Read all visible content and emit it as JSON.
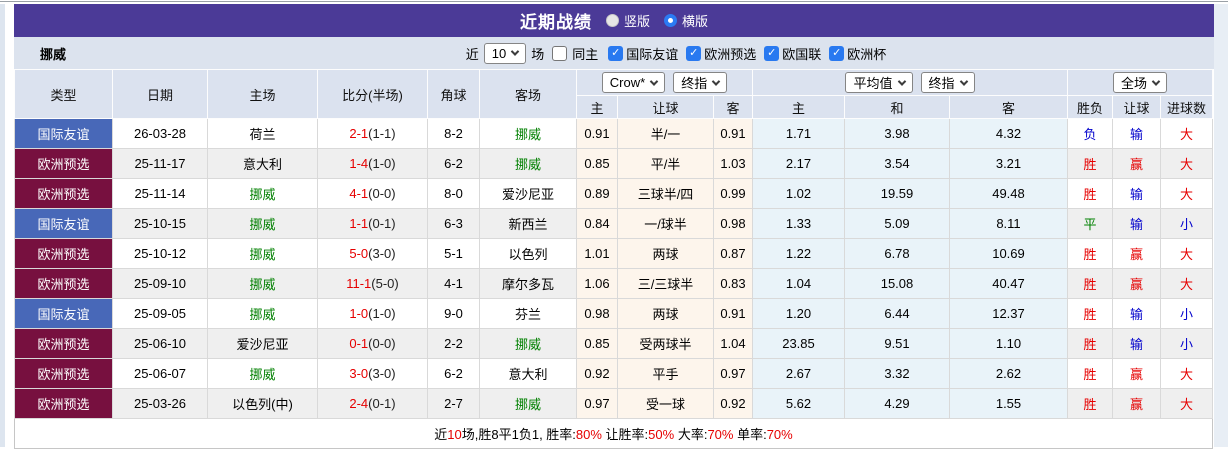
{
  "colors": {
    "header_purple": "#4b3a97",
    "type_friendly_blue": "#4868b8",
    "type_qualifier_maroon": "#77103f",
    "win_red": "#e60000",
    "loss_blue": "#0000cc",
    "draw_green": "#008000",
    "norway_green": "#008000",
    "odds_cream_bg": "#fdf5ec",
    "avg_blue_bg": "#e9f3f9"
  },
  "titlebar": {
    "title": "近期战绩",
    "radio_vertical": "竖版",
    "radio_horizontal": "横版"
  },
  "filterbar": {
    "team": "挪威",
    "near_label": "近",
    "count_value": "10",
    "games_label": "场",
    "same_home_label": "同主",
    "leagues": [
      "国际友谊",
      "欧洲预选",
      "欧国联",
      "欧洲杯"
    ]
  },
  "table": {
    "selects": {
      "bookmaker": "Crow*",
      "bookmaker_final": "终指",
      "average": "平均值",
      "average_final": "终指",
      "scope": "全场"
    },
    "columns": [
      "类型",
      "日期",
      "主场",
      "比分(半场)",
      "角球",
      "客场",
      "主",
      "让球",
      "客",
      "主",
      "和",
      "客",
      "胜负",
      "让球",
      "进球数"
    ],
    "rows": [
      {
        "type": "国际友谊",
        "type_style": "blue",
        "date": "26-03-28",
        "home": "荷兰",
        "home_norway": false,
        "score": "2-1",
        "half": "(1-1)",
        "corners": "8-2",
        "away": "挪威",
        "away_norway": true,
        "o_home": "0.91",
        "handicap": "半/一",
        "o_away": "0.91",
        "a_home": "1.71",
        "a_draw": "3.98",
        "a_away": "4.32",
        "wl": "负",
        "wl_color": "blue",
        "hc": "输",
        "hc_color": "blue",
        "goal": "大",
        "goal_color": "red"
      },
      {
        "type": "欧洲预选",
        "type_style": "maroon",
        "date": "25-11-17",
        "home": "意大利",
        "home_norway": false,
        "score": "1-4",
        "half": "(1-0)",
        "corners": "6-2",
        "away": "挪威",
        "away_norway": true,
        "o_home": "0.85",
        "handicap": "平/半",
        "o_away": "1.03",
        "a_home": "2.17",
        "a_draw": "3.54",
        "a_away": "3.21",
        "wl": "胜",
        "wl_color": "red",
        "hc": "赢",
        "hc_color": "red",
        "goal": "大",
        "goal_color": "red"
      },
      {
        "type": "欧洲预选",
        "type_style": "maroon",
        "date": "25-11-14",
        "home": "挪威",
        "home_norway": true,
        "score": "4-1",
        "half": "(0-0)",
        "corners": "8-0",
        "away": "爱沙尼亚",
        "away_norway": false,
        "o_home": "0.89",
        "handicap": "三球半/四",
        "o_away": "0.99",
        "a_home": "1.02",
        "a_draw": "19.59",
        "a_away": "49.48",
        "wl": "胜",
        "wl_color": "red",
        "hc": "输",
        "hc_color": "blue",
        "goal": "大",
        "goal_color": "red"
      },
      {
        "type": "国际友谊",
        "type_style": "blue",
        "date": "25-10-15",
        "home": "挪威",
        "home_norway": true,
        "score": "1-1",
        "half": "(0-1)",
        "corners": "6-3",
        "away": "新西兰",
        "away_norway": false,
        "o_home": "0.84",
        "handicap": "一/球半",
        "o_away": "0.98",
        "a_home": "1.33",
        "a_draw": "5.09",
        "a_away": "8.11",
        "wl": "平",
        "wl_color": "green",
        "hc": "输",
        "hc_color": "blue",
        "goal": "小",
        "goal_color": "blue"
      },
      {
        "type": "欧洲预选",
        "type_style": "maroon",
        "date": "25-10-12",
        "home": "挪威",
        "home_norway": true,
        "score": "5-0",
        "half": "(3-0)",
        "corners": "5-1",
        "away": "以色列",
        "away_norway": false,
        "o_home": "1.01",
        "handicap": "两球",
        "o_away": "0.87",
        "a_home": "1.22",
        "a_draw": "6.78",
        "a_away": "10.69",
        "wl": "胜",
        "wl_color": "red",
        "hc": "赢",
        "hc_color": "red",
        "goal": "大",
        "goal_color": "red"
      },
      {
        "type": "欧洲预选",
        "type_style": "maroon",
        "date": "25-09-10",
        "home": "挪威",
        "home_norway": true,
        "score": "11-1",
        "half": "(5-0)",
        "corners": "4-1",
        "away": "摩尔多瓦",
        "away_norway": false,
        "o_home": "1.06",
        "handicap": "三/三球半",
        "o_away": "0.83",
        "a_home": "1.04",
        "a_draw": "15.08",
        "a_away": "40.47",
        "wl": "胜",
        "wl_color": "red",
        "hc": "赢",
        "hc_color": "red",
        "goal": "大",
        "goal_color": "red"
      },
      {
        "type": "国际友谊",
        "type_style": "blue",
        "date": "25-09-05",
        "home": "挪威",
        "home_norway": true,
        "score": "1-0",
        "half": "(1-0)",
        "corners": "9-0",
        "away": "芬兰",
        "away_norway": false,
        "o_home": "0.98",
        "handicap": "两球",
        "o_away": "0.91",
        "a_home": "1.20",
        "a_draw": "6.44",
        "a_away": "12.37",
        "wl": "胜",
        "wl_color": "red",
        "hc": "输",
        "hc_color": "blue",
        "goal": "小",
        "goal_color": "blue"
      },
      {
        "type": "欧洲预选",
        "type_style": "maroon",
        "date": "25-06-10",
        "home": "爱沙尼亚",
        "home_norway": false,
        "score": "0-1",
        "half": "(0-0)",
        "corners": "2-2",
        "away": "挪威",
        "away_norway": true,
        "o_home": "0.85",
        "handicap": "受两球半",
        "o_away": "1.04",
        "a_home": "23.85",
        "a_draw": "9.51",
        "a_away": "1.10",
        "wl": "胜",
        "wl_color": "red",
        "hc": "输",
        "hc_color": "blue",
        "goal": "小",
        "goal_color": "blue"
      },
      {
        "type": "欧洲预选",
        "type_style": "maroon",
        "date": "25-06-07",
        "home": "挪威",
        "home_norway": true,
        "score": "3-0",
        "half": "(3-0)",
        "corners": "6-2",
        "away": "意大利",
        "away_norway": false,
        "o_home": "0.92",
        "handicap": "平手",
        "o_away": "0.97",
        "a_home": "2.67",
        "a_draw": "3.32",
        "a_away": "2.62",
        "wl": "胜",
        "wl_color": "red",
        "hc": "赢",
        "hc_color": "red",
        "goal": "大",
        "goal_color": "red"
      },
      {
        "type": "欧洲预选",
        "type_style": "maroon",
        "date": "25-03-26",
        "home": "以色列(中)",
        "home_norway": false,
        "score": "2-4",
        "half": "(0-1)",
        "corners": "2-7",
        "away": "挪威",
        "away_norway": true,
        "o_home": "0.97",
        "handicap": "受一球",
        "o_away": "0.92",
        "a_home": "5.62",
        "a_draw": "4.29",
        "a_away": "1.55",
        "wl": "胜",
        "wl_color": "red",
        "hc": "赢",
        "hc_color": "red",
        "goal": "大",
        "goal_color": "red"
      }
    ]
  },
  "footer": {
    "segments": [
      {
        "text": "近",
        "color": "black"
      },
      {
        "text": "10",
        "color": "red"
      },
      {
        "text": "场,胜8平1负1, 胜率:",
        "color": "black"
      },
      {
        "text": "80%",
        "color": "red"
      },
      {
        "text": " 让胜率:",
        "color": "black"
      },
      {
        "text": "50%",
        "color": "red"
      },
      {
        "text": " 大率:",
        "color": "black"
      },
      {
        "text": "70%",
        "color": "red"
      },
      {
        "text": " 单率:",
        "color": "black"
      },
      {
        "text": "70%",
        "color": "red"
      }
    ]
  },
  "icons": {
    "check": "✓"
  }
}
